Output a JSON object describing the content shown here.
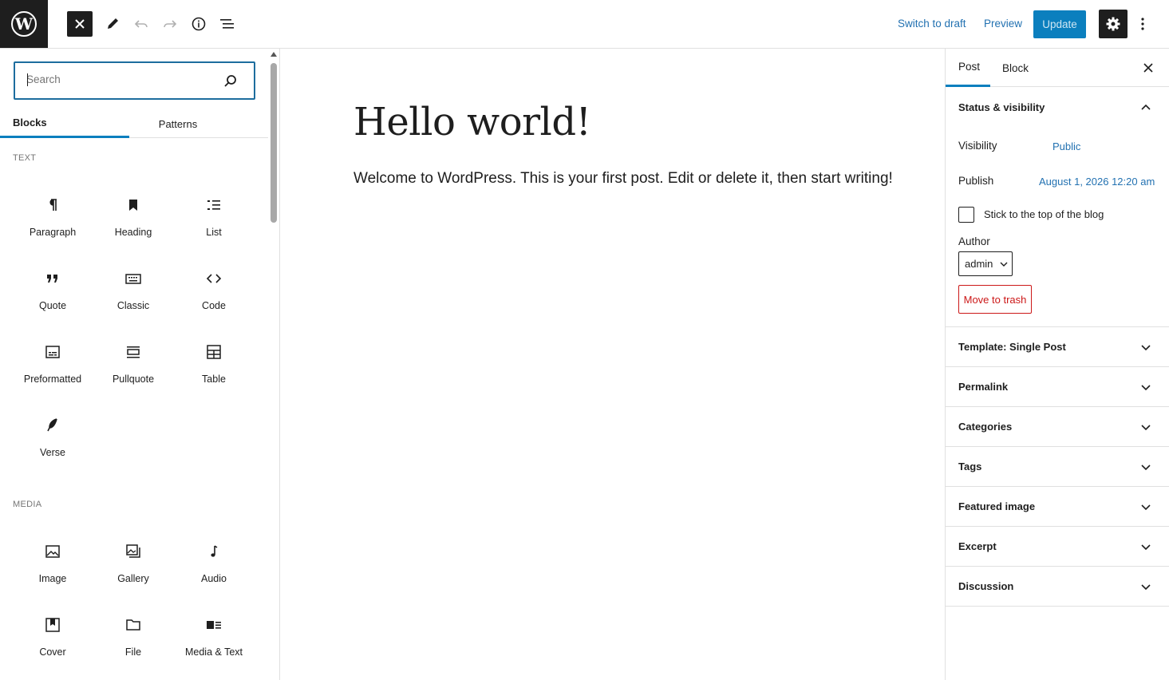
{
  "topbar": {
    "switch_to_draft": "Switch to draft",
    "preview": "Preview",
    "update": "Update"
  },
  "inserter": {
    "search_placeholder": "Search",
    "tabs": {
      "blocks": "Blocks",
      "patterns": "Patterns"
    },
    "sections": {
      "text": {
        "title": "Text",
        "blocks": [
          "Paragraph",
          "Heading",
          "List",
          "Quote",
          "Classic",
          "Code",
          "Preformatted",
          "Pullquote",
          "Table",
          "Verse"
        ]
      },
      "media": {
        "title": "Media",
        "blocks": [
          "Image",
          "Gallery",
          "Audio",
          "Cover",
          "File",
          "Media & Text"
        ]
      }
    }
  },
  "post": {
    "title": "Hello world!",
    "body": "Welcome to WordPress. This is your first post. Edit or delete it, then start writing!"
  },
  "sidebar": {
    "tabs": {
      "post": "Post",
      "block": "Block"
    },
    "status": {
      "title": "Status & visibility",
      "visibility_label": "Visibility",
      "visibility_value": "Public",
      "publish_label": "Publish",
      "publish_value": "August 1, 2026 12:20 am",
      "stick_label": "Stick to the top of the blog",
      "author_label": "Author",
      "author_value": "admin",
      "trash": "Move to trash"
    },
    "panels": [
      "Template: Single Post",
      "Permalink",
      "Categories",
      "Tags",
      "Featured image",
      "Excerpt",
      "Discussion"
    ]
  },
  "colors": {
    "accent": "#0b7fbe",
    "link": "#2271b1",
    "danger": "#cc1818",
    "dark": "#1e1e1e"
  }
}
